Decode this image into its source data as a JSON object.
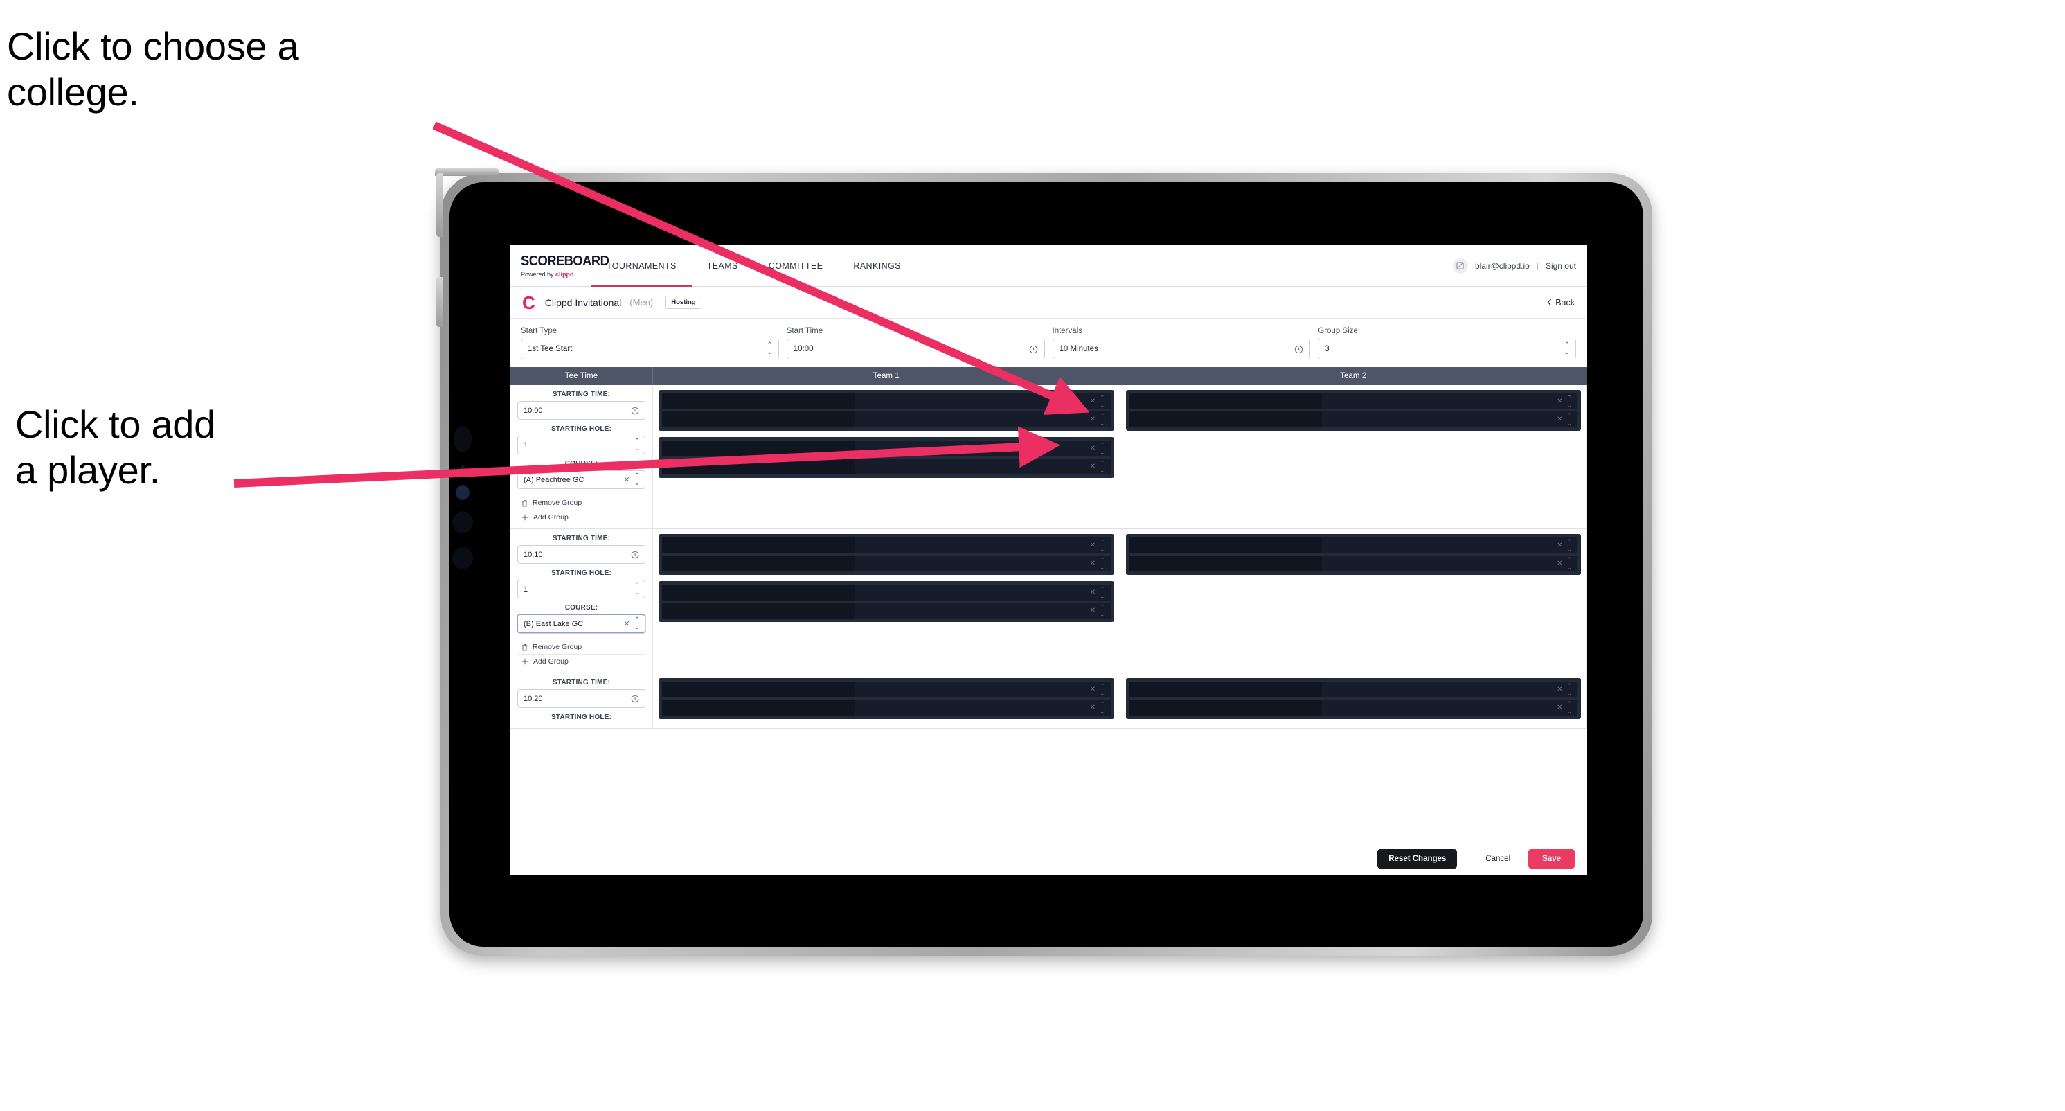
{
  "annotations": {
    "college": "Click to choose a\ncollege.",
    "player": "Click to add\na player."
  },
  "colors": {
    "accent_pink": "#ec3b63",
    "brand_pink": "#e8245c",
    "arrow_pink": "#ec2f63",
    "header_slate": "#4e5566",
    "slot_dark": "#232b3b",
    "dark_button": "#16181d"
  },
  "app": {
    "topnav": {
      "brand": {
        "wordmark": "SCOREBOARD",
        "powered_prefix": "Powered by ",
        "powered_brand": "clippd"
      },
      "tabs": [
        {
          "label": "TOURNAMENTS",
          "active": true
        },
        {
          "label": "TEAMS",
          "active": false
        },
        {
          "label": "COMMITTEE",
          "active": false
        },
        {
          "label": "RANKINGS",
          "active": false
        }
      ],
      "account": {
        "avatar_icon": "user-avatar-icon",
        "email": "blair@clippd.io",
        "separator": "|",
        "sign_out": "Sign out"
      }
    },
    "tournament_header": {
      "logo_letter": "C",
      "name": "Clippd Invitational",
      "gender": "(Men)",
      "role_badge": "Hosting",
      "back_label": "Back",
      "back_icon": "chevron-left-icon"
    },
    "settings": [
      {
        "label": "Start Type",
        "value": "1st Tee Start",
        "icon": "stepper-icon"
      },
      {
        "label": "Start Time",
        "value": "10:00",
        "icon": "clock-icon"
      },
      {
        "label": "Intervals",
        "value": "10 Minutes",
        "icon": "clock-icon"
      },
      {
        "label": "Group Size",
        "value": "3",
        "icon": "stepper-icon"
      }
    ],
    "grid": {
      "columns": [
        "Tee Time",
        "Team 1",
        "Team 2"
      ],
      "field_labels": {
        "starting_time": "STARTING TIME:",
        "starting_hole": "STARTING HOLE:",
        "course": "COURSE:"
      },
      "group_actions": {
        "remove": "Remove Group",
        "remove_icon": "trash-icon",
        "add": "Add Group",
        "add_icon": "plus-icon"
      },
      "slot_icons": {
        "clear": "clear-x-icon",
        "select": "stepper-icon"
      },
      "rows": [
        {
          "starting_time": "10:00",
          "starting_hole": "1",
          "course": "(A) Peachtree GC",
          "course_focused": false,
          "team1_groups": [
            {
              "slots": 2
            },
            {
              "slots": 2
            }
          ],
          "team2_groups": [
            {
              "slots": 2
            }
          ]
        },
        {
          "starting_time": "10:10",
          "starting_hole": "1",
          "course": "(B) East Lake GC",
          "course_focused": true,
          "team1_groups": [
            {
              "slots": 2
            },
            {
              "slots": 2
            }
          ],
          "team2_groups": [
            {
              "slots": 2
            }
          ]
        },
        {
          "starting_time": "10:20",
          "starting_hole": "",
          "course": "",
          "course_focused": false,
          "team1_groups": [
            {
              "slots": 2
            }
          ],
          "team2_groups": [
            {
              "slots": 2
            }
          ]
        }
      ]
    },
    "footer": {
      "reset": "Reset Changes",
      "cancel": "Cancel",
      "save": "Save"
    }
  }
}
